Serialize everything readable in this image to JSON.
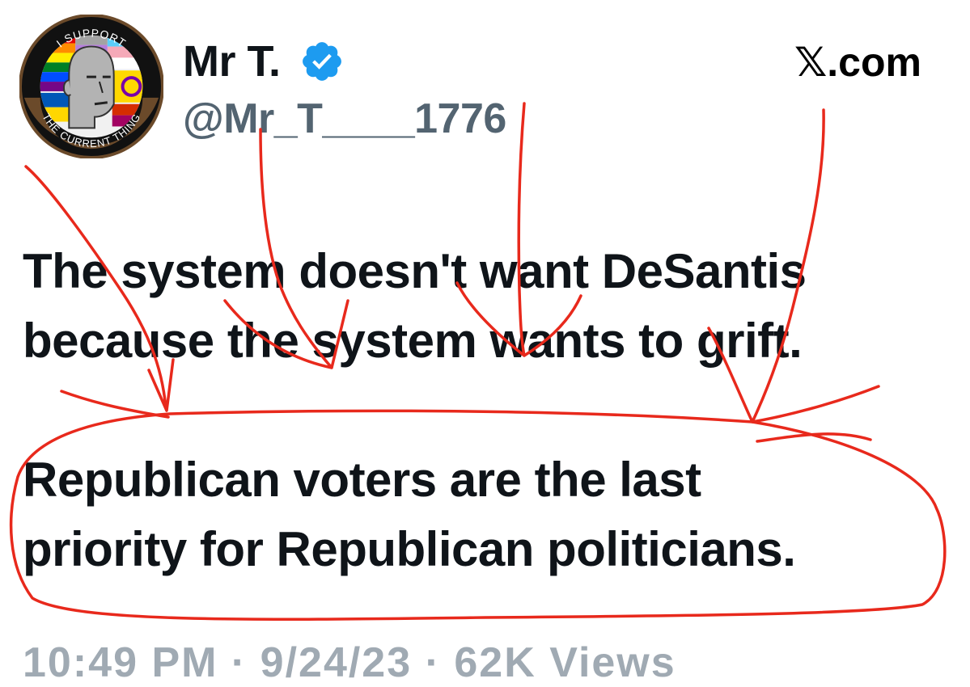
{
  "tweet": {
    "display_name": "Mr T.",
    "handle": "@Mr_T____1776",
    "site": "𝕏.com",
    "paragraphs": [
      [
        "The system doesn't want DeSantis",
        "because the system wants to grift."
      ],
      [
        "Republican voters are the last",
        "priority for Republican politicians."
      ]
    ],
    "timestamp": "10:49 PM · 9/24/23 · 62K Views"
  },
  "avatar": {
    "ring_text_top": "I SUPPORT",
    "ring_text_bottom": "THE CURRENT THING"
  },
  "icons": {
    "verified": "verified-badge-icon",
    "annotation": "red-pen-scribble"
  },
  "colors": {
    "verified_blue": "#1d9bf0",
    "text": "#0f1419",
    "handle_gray": "#536471",
    "annotation_red": "#e8291c"
  }
}
